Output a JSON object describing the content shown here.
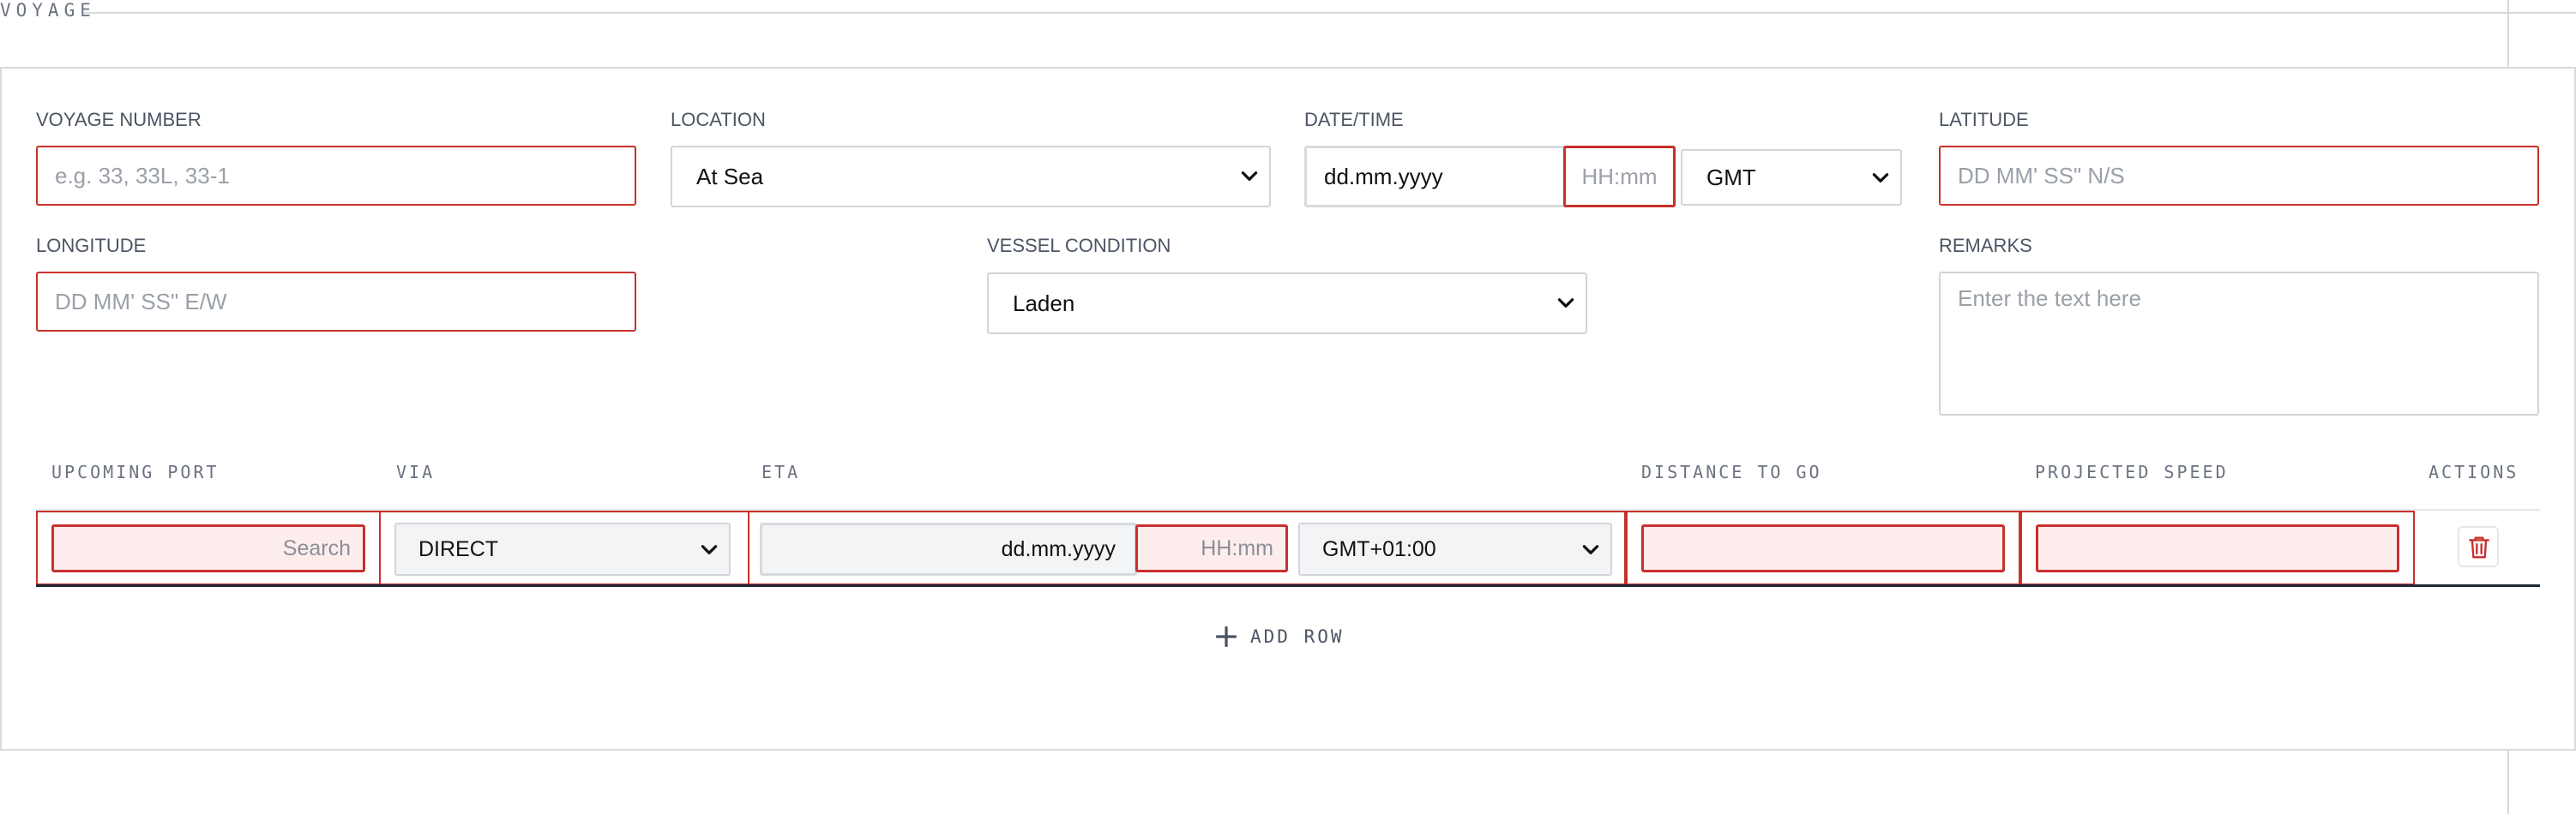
{
  "section": {
    "title": "VOYAGE"
  },
  "form": {
    "voyage_number": {
      "label": "VOYAGE NUMBER",
      "placeholder": "e.g. 33, 33L, 33-1"
    },
    "location": {
      "label": "LOCATION",
      "value": "At Sea"
    },
    "datetime": {
      "label": "DATE/TIME",
      "date_placeholder": "dd.mm.yyyy",
      "time_placeholder": "HH:mm",
      "timezone": "GMT"
    },
    "latitude": {
      "label": "LATITUDE",
      "placeholder": "DD MM' SS\" N/S"
    },
    "longitude": {
      "label": "LONGITUDE",
      "placeholder": "DD MM' SS\" E/W"
    },
    "vessel_condition": {
      "label": "VESSEL CONDITION",
      "value": "Laden"
    },
    "remarks": {
      "label": "REMARKS",
      "placeholder": "Enter the text here"
    }
  },
  "table": {
    "headers": {
      "upcoming_port": "UPCOMING PORT",
      "via": "VIA",
      "eta": "ETA",
      "distance_to_go": "DISTANCE TO GO",
      "projected_speed": "PROJECTED SPEED",
      "actions": "ACTIONS"
    },
    "rows": [
      {
        "port_placeholder": "Search",
        "via": "DIRECT",
        "eta_date_placeholder": "dd.mm.yyyy",
        "eta_time_placeholder": "HH:mm",
        "eta_timezone": "GMT+01:00"
      }
    ],
    "add_row_label": "ADD ROW"
  },
  "colors": {
    "error_border": "#c9302c",
    "error_fill": "#fdecec",
    "delete_icon": "#c9302c"
  },
  "icons": {
    "dropdown": "chevron-down-icon",
    "delete": "trash-icon",
    "add": "plus-icon"
  }
}
